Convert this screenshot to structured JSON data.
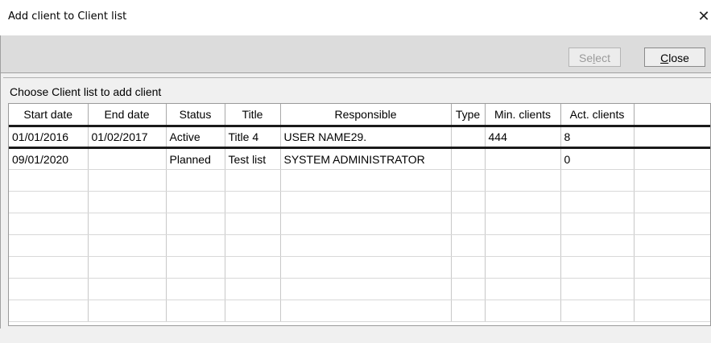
{
  "window": {
    "title": "Add client to Client list",
    "close_glyph": "✕"
  },
  "toolbar": {
    "select_label": "Select",
    "close_label": "Close"
  },
  "section": {
    "label": "Choose Client list to add client"
  },
  "table": {
    "columns": [
      "Start date",
      "End date",
      "Status",
      "Title",
      "Responsible",
      "Type",
      "Min. clients",
      "Act. clients",
      ""
    ],
    "rows": [
      [
        "01/01/2016",
        "01/02/2017",
        "Active",
        "Title 4",
        "USER NAME29.",
        "",
        "444",
        "8",
        ""
      ],
      [
        "09/01/2020",
        "",
        "Planned",
        "Test list",
        "SYSTEM ADMINISTRATOR",
        "",
        "",
        "0",
        ""
      ]
    ],
    "selected_row": 0
  },
  "colors": {
    "toolbar_bg": "#dcdcdc",
    "window_bg": "#f0f0f0",
    "selection_border": "#1a1a1a"
  }
}
